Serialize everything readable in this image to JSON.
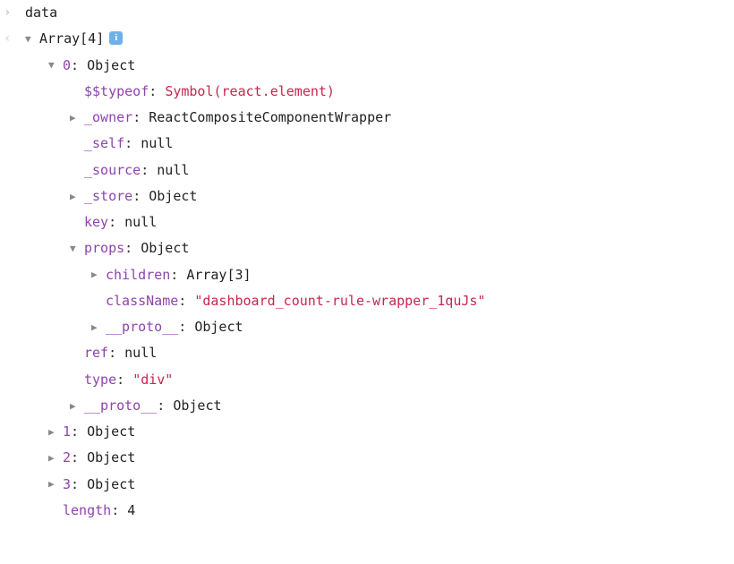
{
  "top": {
    "prompt_label": "data"
  },
  "root": {
    "array_label": "Array[4]"
  },
  "idx0": {
    "label": "0",
    "value": "Object"
  },
  "typeof": {
    "key": "$$typeof",
    "value": "Symbol(react.element)"
  },
  "owner": {
    "key": "_owner",
    "value": "ReactCompositeComponentWrapper"
  },
  "self": {
    "key": "_self",
    "value": "null"
  },
  "source": {
    "key": "_source",
    "value": "null"
  },
  "store": {
    "key": "_store",
    "value": "Object"
  },
  "keyprop": {
    "key": "key",
    "value": "null"
  },
  "props": {
    "key": "props",
    "value": "Object"
  },
  "children": {
    "key": "children",
    "value": "Array[3]"
  },
  "className": {
    "key": "className",
    "value": "\"dashboard_count-rule-wrapper_1quJs\""
  },
  "proto_inner": {
    "key": "__proto__",
    "value": "Object"
  },
  "ref": {
    "key": "ref",
    "value": "null"
  },
  "type": {
    "key": "type",
    "value": "\"div\""
  },
  "proto_outer": {
    "key": "__proto__",
    "value": "Object"
  },
  "idx1": {
    "label": "1",
    "value": "Object"
  },
  "idx2": {
    "label": "2",
    "value": "Object"
  },
  "idx3": {
    "label": "3",
    "value": "Object"
  },
  "length": {
    "key": "length",
    "value": "4"
  }
}
